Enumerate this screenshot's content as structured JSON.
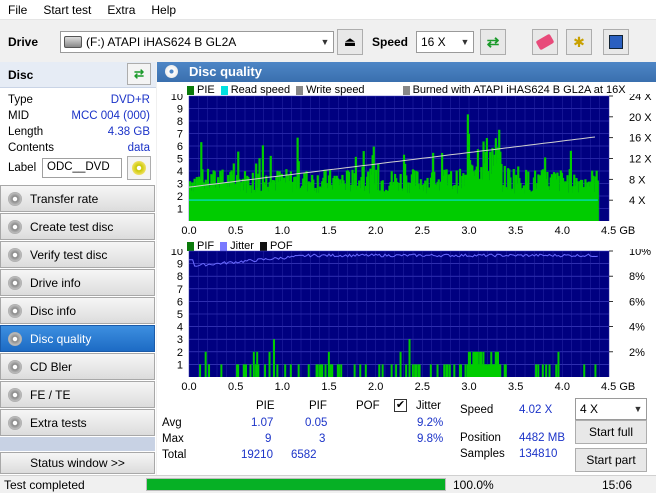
{
  "menu": [
    "File",
    "Start test",
    "Extra",
    "Help"
  ],
  "toolbar": {
    "drive_label": "Drive",
    "drive_value": "(F:)  ATAPI iHAS624   B GL2A",
    "speed_label": "Speed",
    "speed_value": "16 X"
  },
  "disc": {
    "header": "Disc",
    "rows": [
      {
        "key": "Type",
        "value": "DVD+R"
      },
      {
        "key": "MID",
        "value": "MCC 004 (000)"
      },
      {
        "key": "Length",
        "value": "4.38 GB"
      },
      {
        "key": "Contents",
        "value": "data"
      }
    ],
    "label_key": "Label",
    "label_value": "ODC__DVD"
  },
  "nav": [
    "Transfer rate",
    "Create test disc",
    "Verify test disc",
    "Drive info",
    "Disc info",
    "Disc quality",
    "CD Bler",
    "FE / TE",
    "Extra tests"
  ],
  "nav_active": "Disc quality",
  "status_window_label": "Status window >>",
  "panel_title": "Disc quality",
  "chart_data": [
    {
      "type": "bar",
      "legend": [
        "PIE",
        "Read speed",
        "Write speed",
        "Burned with ATAPI iHAS624   B GL2A at 16X"
      ],
      "colors": {
        "pie": "#00cc00",
        "read": "#00e0e0",
        "write": "#888888",
        "bg": "#000080"
      },
      "x_ticks": [
        "0.0",
        "0.5",
        "1.0",
        "1.5",
        "2.0",
        "2.5",
        "3.0",
        "3.5",
        "4.0",
        "4.5 GB"
      ],
      "y_left_ticks": [
        "1",
        "2",
        "3",
        "4",
        "5",
        "6",
        "7",
        "8",
        "9",
        "10"
      ],
      "y_right_ticks": [
        "4 X",
        "8 X",
        "12 X",
        "16 X",
        "20 X",
        "24 X"
      ],
      "xlim": [
        0,
        4.5
      ],
      "ylim": [
        0,
        10
      ],
      "y2lim": [
        0,
        24
      ],
      "max_pie": 9,
      "read_speed_x": 4.02
    },
    {
      "type": "bar",
      "legend": [
        "PIF",
        "Jitter",
        "POF"
      ],
      "colors": {
        "pif": "#00cc00",
        "jitter": "#6a6aff",
        "bg": "#000080"
      },
      "x_ticks": [
        "0.0",
        "0.5",
        "1.0",
        "1.5",
        "2.0",
        "2.5",
        "3.0",
        "3.5",
        "4.0",
        "4.5 GB"
      ],
      "y_left_ticks": [
        "1",
        "2",
        "3",
        "4",
        "5",
        "6",
        "7",
        "8",
        "9",
        "10"
      ],
      "y_right_ticks": [
        "2%",
        "4%",
        "6%",
        "8%",
        "10%"
      ],
      "xlim": [
        0,
        4.5
      ],
      "ylim": [
        0,
        10
      ],
      "y2lim": [
        0,
        10
      ],
      "max_pif": 3,
      "jitter_pct_range": [
        8.8,
        9.8
      ]
    }
  ],
  "stats": {
    "headers": [
      "PIE",
      "PIF",
      "POF",
      "Jitter"
    ],
    "rows": [
      {
        "label": "Avg",
        "pie": "1.07",
        "pif": "0.05",
        "pof": "",
        "jitter": "9.2%"
      },
      {
        "label": "Max",
        "pie": "9",
        "pif": "3",
        "pof": "",
        "jitter": "9.8%"
      },
      {
        "label": "Total",
        "pie": "19210",
        "pif": "6582",
        "pof": "",
        "jitter": ""
      }
    ],
    "jitter_checked": true
  },
  "info": {
    "speed_label": "Speed",
    "speed_value": "4.02 X",
    "position_label": "Position",
    "position_value": "4482 MB",
    "samples_label": "Samples",
    "samples_value": "134810"
  },
  "speed_select": "4 X",
  "start_full_label": "Start full",
  "start_part_label": "Start part",
  "status": {
    "text": "Test completed",
    "progress": 100,
    "progress_label": "100.0%",
    "time": "15:06"
  }
}
